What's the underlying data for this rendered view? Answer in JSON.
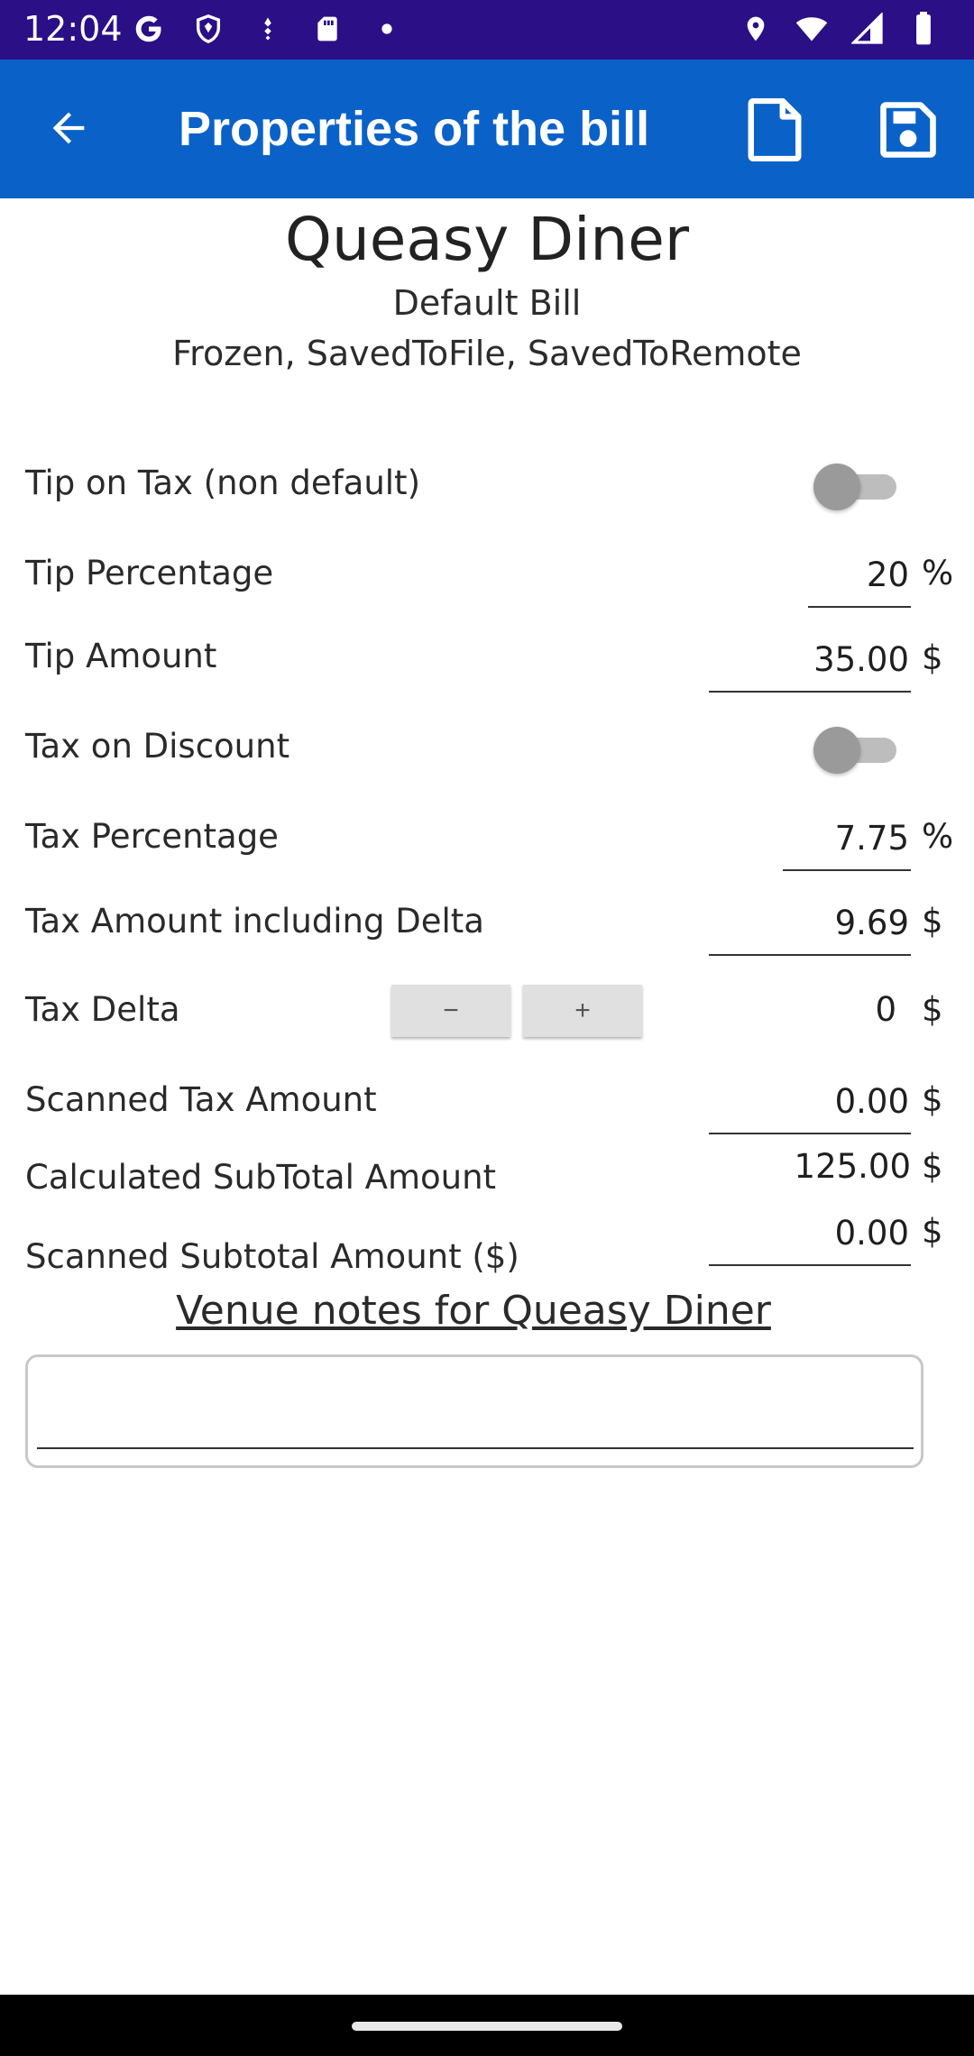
{
  "status_bar": {
    "time": "12:04",
    "left_icons": [
      "google-icon",
      "shield-icon",
      "fitness-icon",
      "sd-card-icon",
      "dot-icon"
    ],
    "right_icons": [
      "location-icon",
      "wifi-icon",
      "signal-icon",
      "battery-icon"
    ]
  },
  "app_bar": {
    "title": "Properties of the bill",
    "color": "#0a62c8"
  },
  "header": {
    "venue_name": "Queasy Diner",
    "bill_name": "Default Bill",
    "bill_state": "Frozen, SavedToFile, SavedToRemote"
  },
  "form": {
    "tip_on_tax": {
      "label": "Tip on Tax (non default)",
      "on": false
    },
    "tip_percentage": {
      "label": "Tip Percentage",
      "value": "20",
      "unit": "%"
    },
    "tip_amount": {
      "label": "Tip Amount",
      "value": "35.00",
      "unit": "$"
    },
    "tax_on_discount": {
      "label": "Tax on Discount",
      "on": false
    },
    "tax_percentage": {
      "label": "Tax Percentage",
      "value": "7.75",
      "unit": "%"
    },
    "tax_amount": {
      "label": "Tax Amount including Delta",
      "value": "9.69",
      "unit": "$"
    },
    "tax_delta": {
      "label": "Tax Delta",
      "minus": "−",
      "plus": "+",
      "value": "0",
      "unit": "$"
    },
    "scanned_tax": {
      "label": "Scanned Tax Amount",
      "value": "0.00",
      "unit": "$"
    },
    "calc_subtotal": {
      "label": "Calculated SubTotal Amount",
      "value": "125.00",
      "unit": "$"
    },
    "scanned_subtotal": {
      "label": "Scanned Subtotal Amount ($)",
      "value": "0.00",
      "unit": "$"
    }
  },
  "notes": {
    "heading": "Venue notes for Queasy Diner",
    "value": "",
    "placeholder": ""
  }
}
